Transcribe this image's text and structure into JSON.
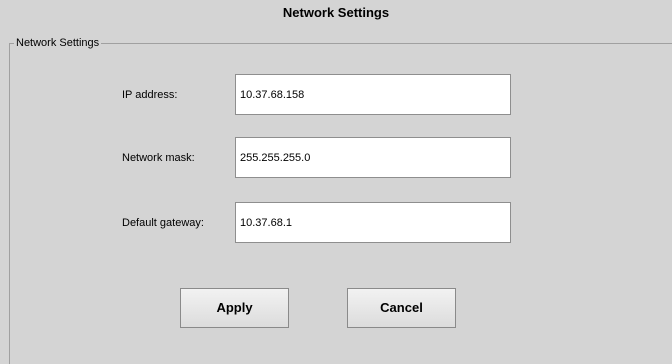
{
  "window": {
    "title": "Network Settings"
  },
  "group": {
    "legend": "Network Settings"
  },
  "fields": [
    {
      "label": "IP address:",
      "value": "10.37.68.158"
    },
    {
      "label": "Network mask:",
      "value": "255.255.255.0"
    },
    {
      "label": "Default gateway:",
      "value": "10.37.68.1"
    }
  ],
  "buttons": {
    "apply_label": "Apply",
    "cancel_label": "Cancel"
  }
}
